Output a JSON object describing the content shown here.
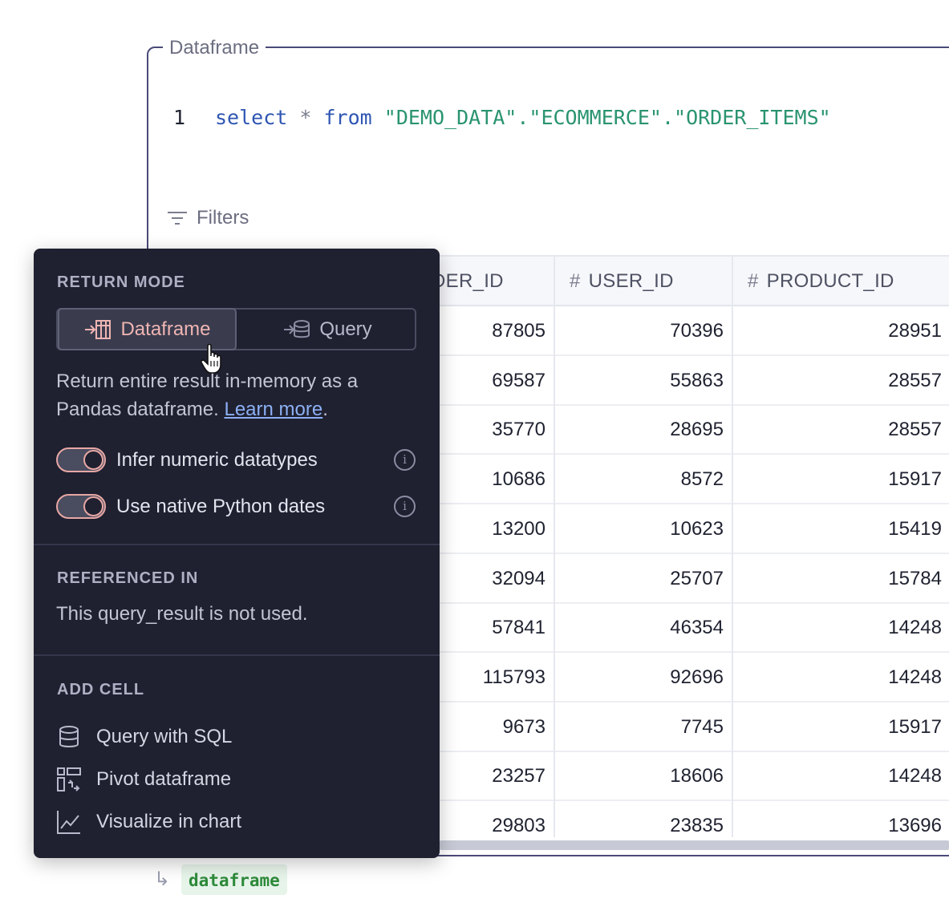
{
  "cell": {
    "legend": "Dataframe",
    "code": {
      "line_number": "1",
      "keyword_select": "select",
      "star": "*",
      "keyword_from": "from",
      "table_ref": "\"DEMO_DATA\".\"ECOMMERCE\".\"ORDER_ITEMS\""
    },
    "filters_label": "Filters",
    "output_chip": "dataframe"
  },
  "table": {
    "columns": [
      {
        "label": "DER_ID",
        "type_icon": "hash-icon"
      },
      {
        "label": "USER_ID",
        "type_icon": "hash-icon",
        "type_symbol": "#"
      },
      {
        "label": "PRODUCT_ID",
        "type_icon": "hash-icon",
        "type_symbol": "#"
      }
    ],
    "rows": [
      [
        "87805",
        "70396",
        "28951"
      ],
      [
        "69587",
        "55863",
        "28557"
      ],
      [
        "35770",
        "28695",
        "28557"
      ],
      [
        "10686",
        "8572",
        "15917"
      ],
      [
        "13200",
        "10623",
        "15419"
      ],
      [
        "32094",
        "25707",
        "15784"
      ],
      [
        "57841",
        "46354",
        "14248"
      ],
      [
        "115793",
        "92696",
        "14248"
      ],
      [
        "9673",
        "7745",
        "15917"
      ],
      [
        "23257",
        "18606",
        "14248"
      ],
      [
        "29803",
        "23835",
        "13696"
      ]
    ]
  },
  "popover": {
    "return_mode": {
      "title": "RETURN MODE",
      "options": [
        {
          "label": "Dataframe",
          "icon": "dataframe-icon",
          "selected": true
        },
        {
          "label": "Query",
          "icon": "query-icon",
          "selected": false
        }
      ],
      "description": "Return entire result in-memory as a Pandas dataframe.",
      "learn_more": "Learn more",
      "period": ".",
      "toggles": [
        {
          "label": "Infer numeric datatypes",
          "on": true
        },
        {
          "label": "Use native Python dates",
          "on": true
        }
      ],
      "info_glyph": "i"
    },
    "referenced_in": {
      "title": "REFERENCED IN",
      "text": "This query_result is not used."
    },
    "add_cell": {
      "title": "ADD CELL",
      "items": [
        {
          "label": "Query with SQL",
          "icon": "database-icon"
        },
        {
          "label": "Pivot dataframe",
          "icon": "pivot-icon"
        },
        {
          "label": "Visualize in chart",
          "icon": "chart-icon"
        }
      ]
    }
  },
  "colors": {
    "accent": "#f0b5b3",
    "popover_bg": "#1f2030",
    "link": "#8cb0f4",
    "keyword": "#2f56b3",
    "string": "#2a9470"
  }
}
